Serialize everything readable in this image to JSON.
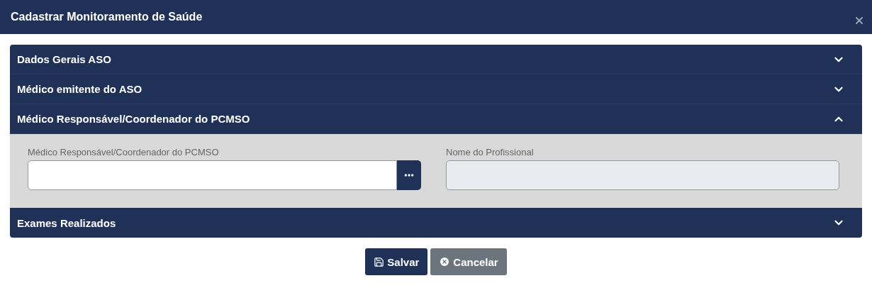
{
  "window": {
    "title": "Cadastrar Monitoramento de Saúde"
  },
  "sections": [
    {
      "title": "Dados Gerais ASO",
      "expanded": false
    },
    {
      "title": "Médico emitente do ASO",
      "expanded": false
    },
    {
      "title": "Médico Responsável/Coordenador do PCMSO",
      "expanded": true,
      "fields": [
        {
          "kind": "lookup",
          "label": "Médico Responsável/Coordenador do PCMSO",
          "disabled": false
        },
        {
          "kind": "text",
          "label": "Nome do Profissional",
          "disabled": true
        }
      ]
    },
    {
      "title": "Exames Realizados",
      "expanded": false
    }
  ],
  "buttons": [
    {
      "kind": "save",
      "label": "Salvar"
    },
    {
      "kind": "cancel",
      "label": "Cancelar"
    }
  ]
}
